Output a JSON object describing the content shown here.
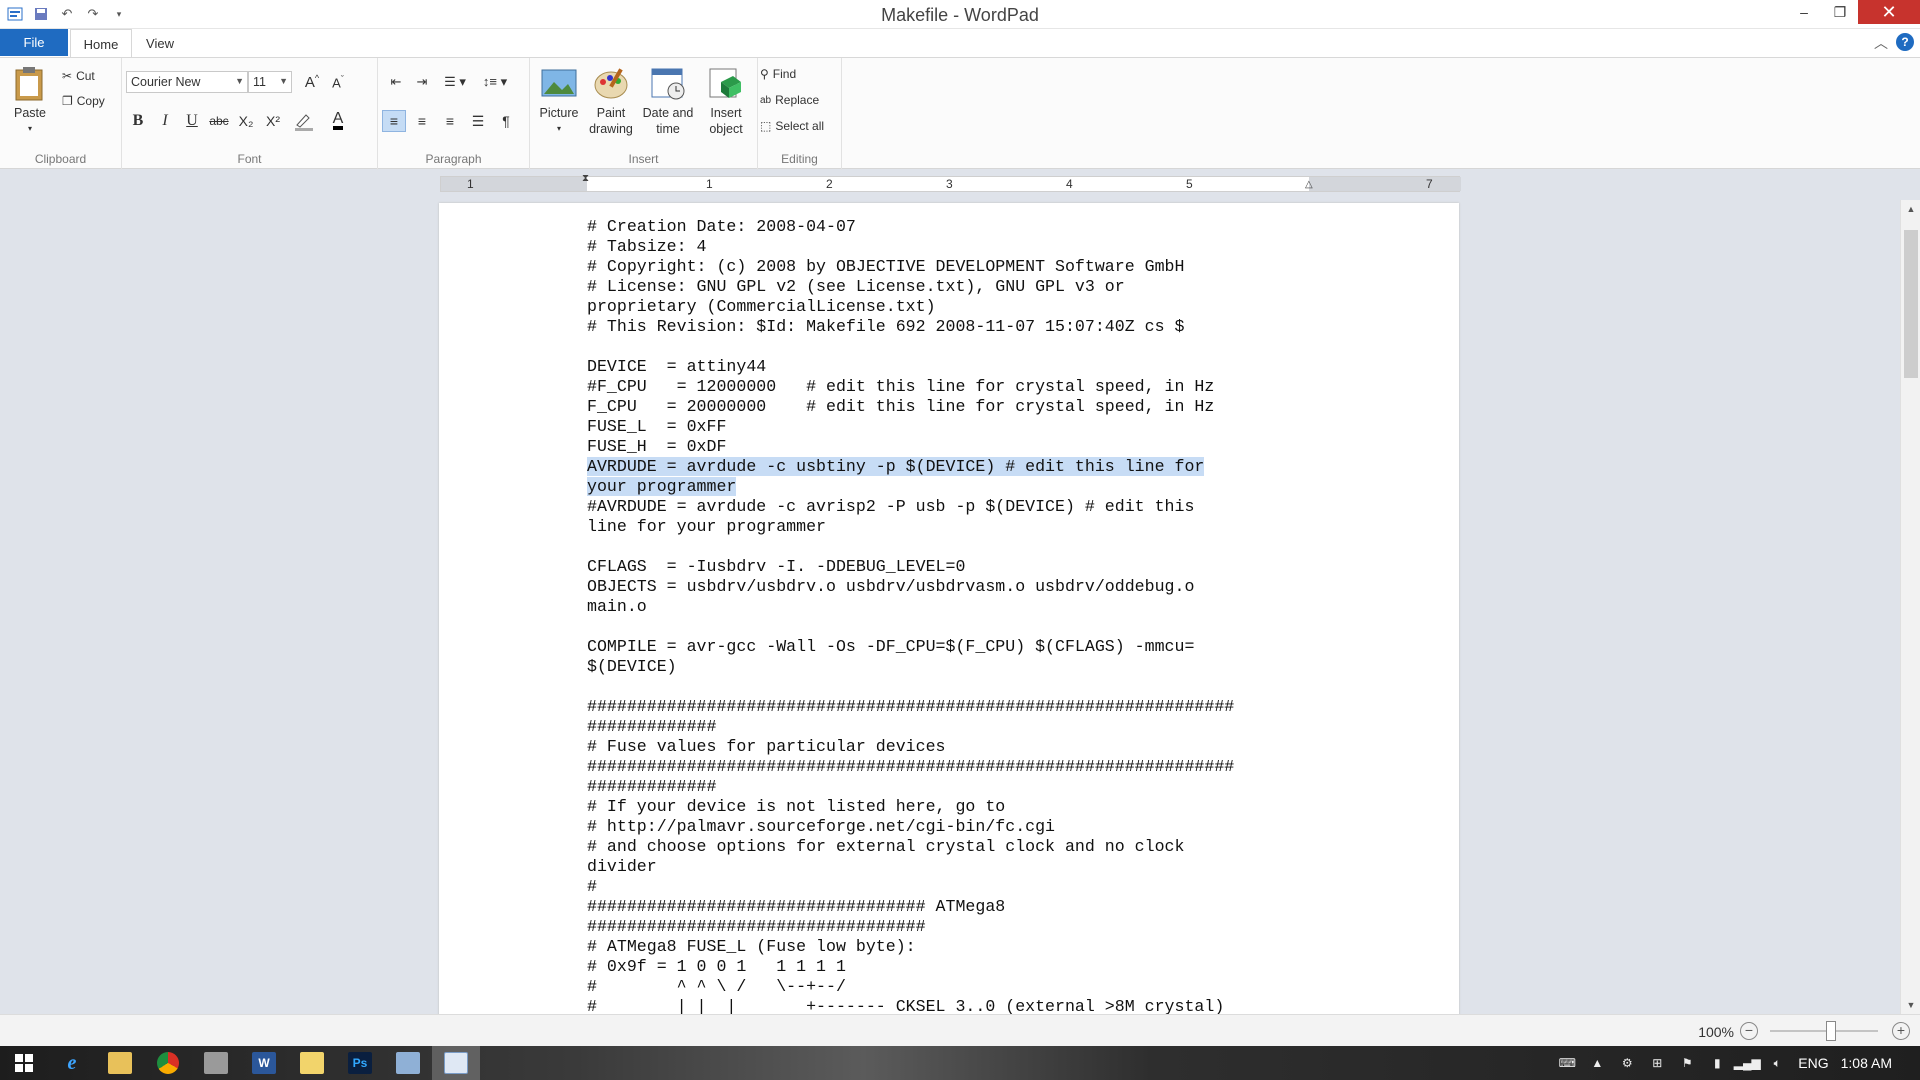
{
  "window": {
    "title": "Makefile - WordPad",
    "controls": {
      "minimize": "–",
      "restore": "❐",
      "close": "✕"
    }
  },
  "qat": {
    "save_icon": "save-icon",
    "undo_icon": "undo-icon",
    "redo_icon": "redo-icon",
    "customize_icon": "chevron-down-icon"
  },
  "tabs": {
    "file": "File",
    "home": "Home",
    "view": "View"
  },
  "ribbon": {
    "clipboard": {
      "label": "Clipboard",
      "paste": "Paste",
      "cut": "Cut",
      "copy": "Copy"
    },
    "font": {
      "label": "Font",
      "font_name": "Courier New",
      "font_size": "11",
      "bold": "B",
      "italic": "I",
      "underline": "U",
      "strike": "abc",
      "subscript": "X₂",
      "superscript": "X²",
      "font_color": "A"
    },
    "paragraph": {
      "label": "Paragraph"
    },
    "insert": {
      "label": "Insert",
      "picture": "Picture",
      "paint_drawing_1": "Paint",
      "paint_drawing_2": "drawing",
      "date_time_1": "Date and",
      "date_time_2": "time",
      "insert_object_1": "Insert",
      "insert_object_2": "object"
    },
    "editing": {
      "label": "Editing",
      "find": "Find",
      "replace": "Replace",
      "select_all": "Select all"
    }
  },
  "ruler": {
    "numbers": [
      "1",
      "1",
      "2",
      "3",
      "4",
      "5",
      "7"
    ]
  },
  "document": {
    "lines": [
      "# Creation Date: 2008-04-07",
      "# Tabsize: 4",
      "# Copyright: (c) 2008 by OBJECTIVE DEVELOPMENT Software GmbH",
      "# License: GNU GPL v2 (see License.txt), GNU GPL v3 or",
      "proprietary (CommercialLicense.txt)",
      "# This Revision: $Id: Makefile 692 2008-11-07 15:07:40Z cs $",
      "",
      "DEVICE  = attiny44",
      "#F_CPU   = 12000000   # edit this line for crystal speed, in Hz",
      "F_CPU   = 20000000    # edit this line for crystal speed, in Hz",
      "FUSE_L  = 0xFF",
      "FUSE_H  = 0xDF",
      "AVRDUDE = avrdude -c usbtiny -p $(DEVICE) # edit this line for",
      "your programmer",
      "#AVRDUDE = avrdude -c avrisp2 -P usb -p $(DEVICE) # edit this",
      "line for your programmer",
      "",
      "CFLAGS  = -Iusbdrv -I. -DDEBUG_LEVEL=0",
      "OBJECTS = usbdrv/usbdrv.o usbdrv/usbdrvasm.o usbdrv/oddebug.o",
      "main.o",
      "",
      "COMPILE = avr-gcc -Wall -Os -DF_CPU=$(F_CPU) $(CFLAGS) -mmcu=",
      "$(DEVICE)",
      "",
      "#################################################################",
      "#############",
      "# Fuse values for particular devices",
      "#################################################################",
      "#############",
      "# If your device is not listed here, go to",
      "# http://palmavr.sourceforge.net/cgi-bin/fc.cgi",
      "# and choose options for external crystal clock and no clock",
      "divider",
      "#",
      "################################## ATMega8",
      "##################################",
      "# ATMega8 FUSE_L (Fuse low byte):",
      "# 0x9f = 1 0 0 1   1 1 1 1",
      "#        ^ ^ \\ /   \\--+--/",
      "#        | |  |       +------- CKSEL 3..0 (external >8M crystal)"
    ],
    "selected_lines": [
      12,
      13
    ]
  },
  "status": {
    "zoom": "100%",
    "zoom_level": 0.5,
    "zoom_out": "−",
    "zoom_in": "+"
  },
  "taskbar": {
    "apps": [
      "start-icon",
      "internet-explorer-icon",
      "file-explorer-icon",
      "chrome-icon",
      "app-icon",
      "word-icon",
      "folder-icon",
      "photoshop-icon",
      "app2-icon",
      "wordpad-icon"
    ],
    "language": "ENG",
    "clock": "1:08 AM"
  }
}
